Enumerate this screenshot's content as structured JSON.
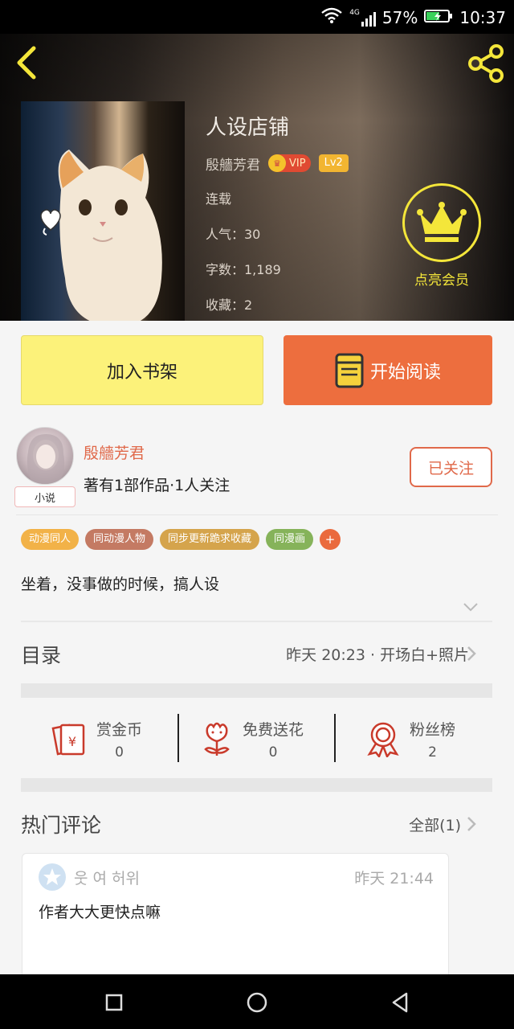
{
  "status_bar": {
    "network": "4G",
    "battery": "57%",
    "time": "10:37"
  },
  "header": {
    "back_icon": "chevron-left-icon",
    "share_icon": "share-icon"
  },
  "book": {
    "title": "人设店铺",
    "author": "殷艢芳君",
    "vip_label": "VIP",
    "level_label": "Lv2",
    "status": "连载",
    "popularity": "人气：30",
    "word_count": "字数：1,189",
    "favorites": "收藏：2"
  },
  "member": {
    "label": "点亮会员",
    "icon": "crown-icon"
  },
  "actions": {
    "shelf_label": "加入书架",
    "read_label": "开始阅读"
  },
  "author_section": {
    "name": "殷艢芳君",
    "tag": "小说",
    "stats": "著有1部作品·1人关注",
    "follow_label": "已关注"
  },
  "tags": [
    {
      "label": "动漫同人",
      "color": "#f2b248"
    },
    {
      "label": "同动漫人物",
      "color": "#c47a63"
    },
    {
      "label": "同步更新跪求收藏",
      "color": "#d5a44c"
    },
    {
      "label": "同漫画",
      "color": "#86b35a"
    }
  ],
  "tags_more": "+",
  "description": "坐着，没事做的时候，搞人设",
  "toc": {
    "title": "目录",
    "latest": "昨天 20:23 · 开场白+照片"
  },
  "rewards": [
    {
      "label": "赏金币",
      "value": "0",
      "icon": "red-envelope-icon"
    },
    {
      "label": "免费送花",
      "value": "0",
      "icon": "flower-icon"
    },
    {
      "label": "粉丝榜",
      "value": "2",
      "icon": "medal-icon"
    }
  ],
  "comments": {
    "title": "热门评论",
    "all_label": "全部(1)",
    "items": [
      {
        "user": "웃 여 허위",
        "time": "昨天 21:44",
        "text": "作者大大更快点嘛"
      }
    ]
  },
  "colors": {
    "accent_orange": "#ed6e3e",
    "shelf_yellow": "#fcf27a",
    "member_yellow": "#f4e63a",
    "author_red": "#e0694a"
  }
}
